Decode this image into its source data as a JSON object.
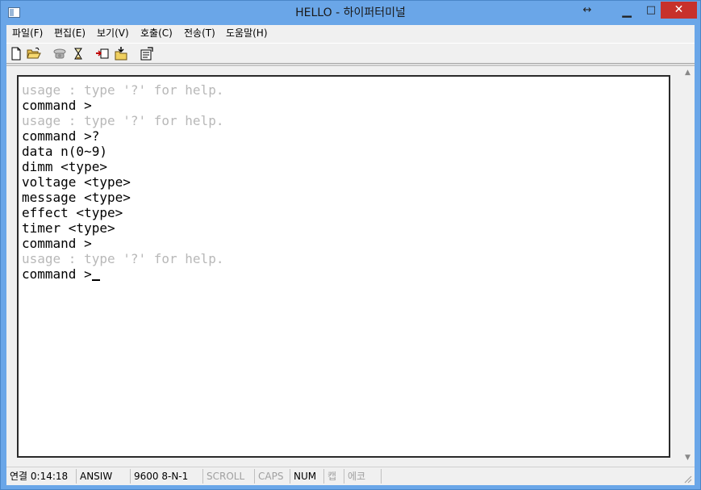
{
  "window": {
    "title": "HELLO - 하이퍼터미널",
    "resize_glyph": "↔",
    "min_glyph": "▁",
    "max_glyph": "□",
    "close_glyph": "✕"
  },
  "menu": {
    "items": [
      {
        "label": "파일(F)"
      },
      {
        "label": "편집(E)"
      },
      {
        "label": "보기(V)"
      },
      {
        "label": "호출(C)"
      },
      {
        "label": "전송(T)"
      },
      {
        "label": "도움말(H)"
      }
    ]
  },
  "toolbar": {
    "tools": [
      {
        "name": "new-icon"
      },
      {
        "name": "open-icon"
      },
      {
        "name": "connect-phone-icon"
      },
      {
        "name": "disconnect-icon"
      },
      {
        "name": "send-icon"
      },
      {
        "name": "receive-icon"
      },
      {
        "name": "properties-icon"
      }
    ]
  },
  "terminal": {
    "lines": [
      {
        "text": "usage : type '?' for help.",
        "dim": true
      },
      {
        "text": "command >",
        "dim": false
      },
      {
        "text": "usage : type '?' for help.",
        "dim": true
      },
      {
        "text": "command >?",
        "dim": false
      },
      {
        "text": "data n(0~9)",
        "dim": false
      },
      {
        "text": "dimm <type>",
        "dim": false
      },
      {
        "text": "voltage <type>",
        "dim": false
      },
      {
        "text": "message <type>",
        "dim": false
      },
      {
        "text": "effect <type>",
        "dim": false
      },
      {
        "text": "timer <type>",
        "dim": false
      },
      {
        "text": "command >",
        "dim": false
      },
      {
        "text": "usage : type '?' for help.",
        "dim": true
      },
      {
        "text": "command >",
        "dim": false
      }
    ]
  },
  "statusbar": {
    "connection": "연결 0:14:18",
    "emulation": "ANSIW",
    "port_settings": "9600 8-N-1",
    "scroll": "SCROLL",
    "caps": "CAPS",
    "num": "NUM",
    "capture": "캡",
    "echo": "에코"
  },
  "colors": {
    "titlebar": "#6aa6e8",
    "close_button": "#c7312b",
    "dim_text": "#b8b8b8"
  }
}
